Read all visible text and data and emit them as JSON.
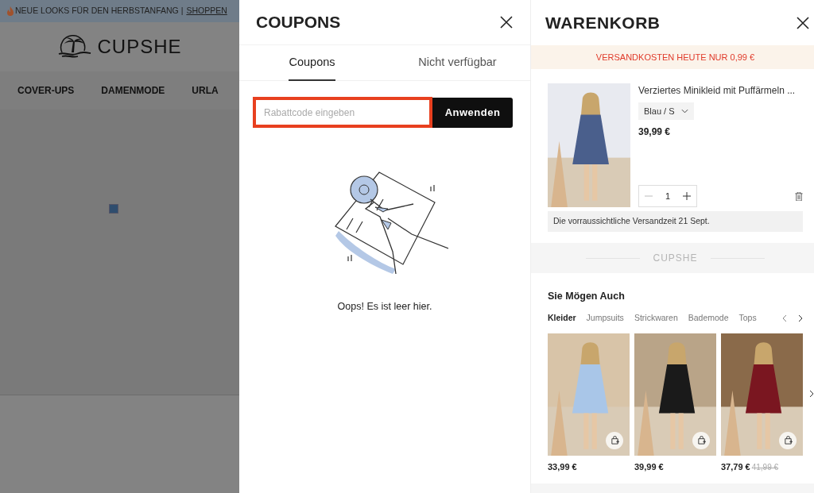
{
  "background_page": {
    "announcement": {
      "text": "NEUE LOOKS FÜR DEN HERBSTANFANG |",
      "link": "SHOPPEN"
    },
    "logo": "CUPSHE",
    "nav": [
      {
        "label": "COVER-UPS"
      },
      {
        "label": "DAMENMODE"
      },
      {
        "label": "URLA"
      }
    ]
  },
  "coupons": {
    "title": "COUPONS",
    "tabs": [
      {
        "label": "Coupons",
        "selected": true
      },
      {
        "label": "Nicht verfügbar",
        "selected": false
      }
    ],
    "code_field": {
      "placeholder": "Rabattcode eingeben"
    },
    "apply_button": "Anwenden",
    "empty_message": "Oops! Es ist leer hier."
  },
  "cart": {
    "title": "WARENKORB",
    "shipping_banner": "VERSANDKOSTEN HEUTE NUR 0,99 €",
    "item": {
      "name": "Verziertes Minikleid mit Puffärmeln ...",
      "variant": "Blau / S",
      "price": "39,99 €",
      "quantity": "1",
      "delivery_note": "Die vorraussichtliche Versandzeit 21 Sept."
    },
    "brand_divider": "CUPSHE",
    "recommendations": {
      "title": "Sie Mögen Auch",
      "categories": [
        {
          "label": "Kleider",
          "selected": true
        },
        {
          "label": "Jumpsuits",
          "selected": false
        },
        {
          "label": "Strickwaren",
          "selected": false
        },
        {
          "label": "Bademode",
          "selected": false
        },
        {
          "label": "Tops",
          "selected": false
        }
      ],
      "products": [
        {
          "price": "33,99 €"
        },
        {
          "price": "39,99 €"
        },
        {
          "price": "37,79 €",
          "old_price": "41,99 €"
        }
      ]
    }
  }
}
